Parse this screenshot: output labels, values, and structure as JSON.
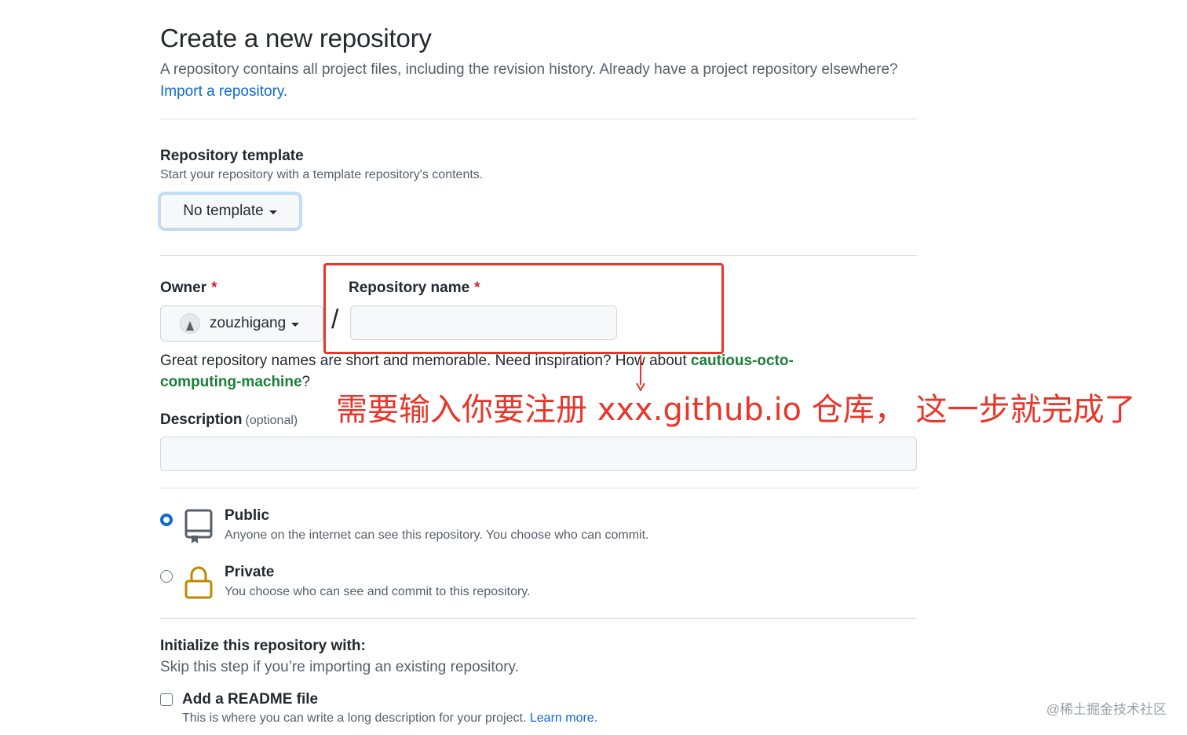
{
  "header": {
    "title": "Create a new repository",
    "intro": "A repository contains all project files, including the revision history. Already have a project repository elsewhere?",
    "import_link": "Import a repository."
  },
  "template_section": {
    "title": "Repository template",
    "note": "Start your repository with a template repository's contents.",
    "button_label": "No template"
  },
  "owner": {
    "label": "Owner",
    "required_mark": "*",
    "value": "zouzhigang"
  },
  "separator": "/",
  "repo_name": {
    "label": "Repository name",
    "required_mark": "*",
    "value": "",
    "placeholder": ""
  },
  "name_hint": {
    "text": "Great repository names are short and memorable. Need inspiration? How about",
    "suggestion": "cautious-octo-computing-machine",
    "end": "?"
  },
  "annotation": {
    "text": "需要输入你要注册 xxx.github.io 仓库， 这一步就完成了",
    "color": "#e8362a"
  },
  "description": {
    "label": "Description",
    "optional_label": "(optional)",
    "value": "",
    "placeholder": ""
  },
  "visibility": {
    "public": {
      "title": "Public",
      "note": "Anyone on the internet can see this repository. You choose who can commit.",
      "selected": true
    },
    "private": {
      "title": "Private",
      "note": "You choose who can see and commit to this repository.",
      "selected": false
    }
  },
  "initialize": {
    "title": "Initialize this repository with:",
    "note": "Skip this step if you’re importing an existing repository.",
    "readme_label": "Add a README file",
    "readme_note": "This is where you can write a long description for your project.",
    "learn_more": "Learn more."
  },
  "watermark": "@稀土掘金技术社区",
  "colors": {
    "link": "#0969da",
    "suggestion": "#1a7f37",
    "required": "#cf222e",
    "annotation": "#e8362a",
    "lock_icon": "#bf8700"
  },
  "icons": {
    "public": "repo-icon",
    "private": "lock-icon",
    "dropdown": "caret-down-icon"
  }
}
